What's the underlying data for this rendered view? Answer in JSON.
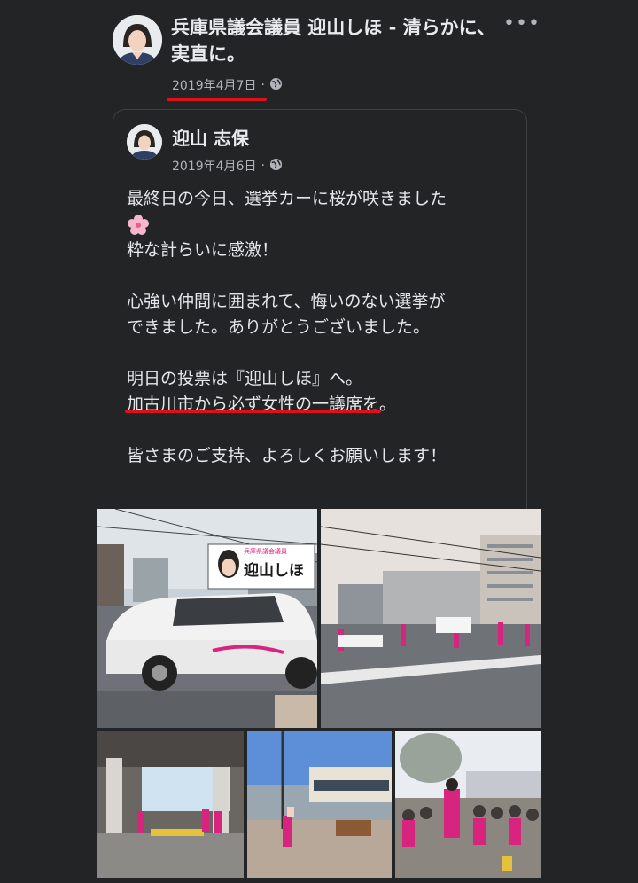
{
  "outer_post": {
    "page_name": "兵庫県議会議員 迎山しほ - 清らかに、実直に。",
    "date": "2019年4月7日",
    "separator": "·",
    "more_label": "•••",
    "privacy_icon": "globe-icon"
  },
  "shared_post": {
    "author": "迎山 志保",
    "date": "2019年4月6日",
    "separator": "·",
    "privacy_icon": "globe-icon",
    "lines": {
      "l1": "最終日の今日、選挙カーに桜が咲きました",
      "l2": "粋な計らいに感激！",
      "l3": "心強い仲間に囲まれて、悔いのない選挙が",
      "l4": "できました。ありがとうございました。",
      "l5": "明日の投票は『迎山しほ』へ。",
      "l6": "加古川市から必ず女性の一議席を。",
      "l7": "皆さまのご支持、よろしくお願いします！"
    },
    "emoji_icon": "cherry-blossom-icon"
  },
  "photos": {
    "car_sign_text": "迎山しほ",
    "car_sign_small": "兵庫県議会議員"
  },
  "colors": {
    "background": "#232426",
    "text": "#e4e6eb",
    "secondary_text": "#b0b3b8",
    "underline": "#e0101a",
    "campaign_pink": "#d6247f"
  }
}
